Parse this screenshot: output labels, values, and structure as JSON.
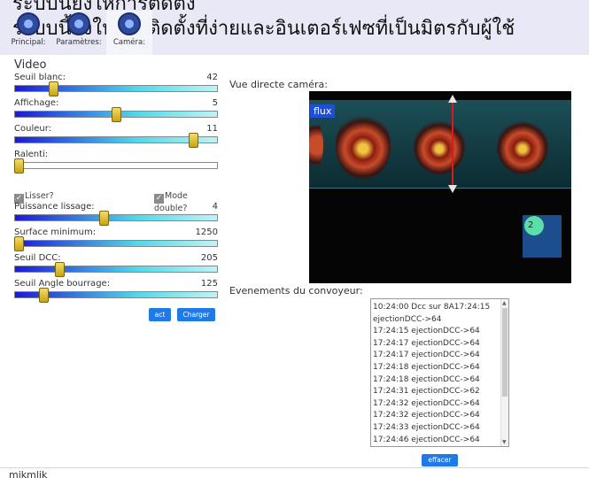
{
  "banner": {
    "text": "ระบบนี้ยังให้การติดตั้งที่ง่ายและอินเตอร์เฟซที่เป็นมิตรกับผู้ใช้",
    "tabs": [
      {
        "label": "Principal:",
        "icon": "home-icon"
      },
      {
        "label": "Paramètres:",
        "icon": "settings-icon"
      },
      {
        "label": "Caméra:",
        "icon": "camera-icon"
      }
    ]
  },
  "video": {
    "title": "Video",
    "sliders": [
      {
        "label": "Seuil blanc:",
        "value": "42",
        "level": 0.18
      },
      {
        "label": "Affichage:",
        "value": "5",
        "level": 0.5
      },
      {
        "label": "Couleur:",
        "value": "11",
        "level": 0.9
      },
      {
        "label": "Ralenti:",
        "value": "",
        "level": 0.0
      }
    ],
    "checkboxes": {
      "smooth": "Lisser?",
      "double": "Mode double?"
    },
    "sliders2": [
      {
        "label": "Puissance lissage:",
        "value": "4",
        "level": 0.44
      },
      {
        "label": "Surface minimum:",
        "value": "1250",
        "level": 0.0
      },
      {
        "label": "Seuil DCC:",
        "value": "205",
        "level": 0.21
      },
      {
        "label": "Seuil Angle bourrage:",
        "value": "125",
        "level": 0.13
      }
    ],
    "buttons": {
      "act": "act",
      "load": "Charger"
    }
  },
  "camera": {
    "label": "Vue directe caméra:",
    "overlay": "flux",
    "badge": "2"
  },
  "events": {
    "label": "Evenements du convoyeur:",
    "lines": [
      "10:24:00 Dcc sur 8A17:24:15",
      "ejectionDCC->64",
      "17:24:15 ejectionDCC->64",
      "17:24:17 ejectionDCC->64",
      "17:24:17 ejectionDCC->64",
      "17:24:18 ejectionDCC->64",
      "17:24:18 ejectionDCC->64",
      "17:24:31 ejectionDCC->62",
      "17:24:32 ejectionDCC->64",
      "17:24:32 ejectionDCC->64",
      "17:24:33 ejectionDCC->64",
      "17:24:46 ejectionDCC->64"
    ],
    "clear": "effacer"
  },
  "footer": {
    "text": "mikmlik"
  }
}
